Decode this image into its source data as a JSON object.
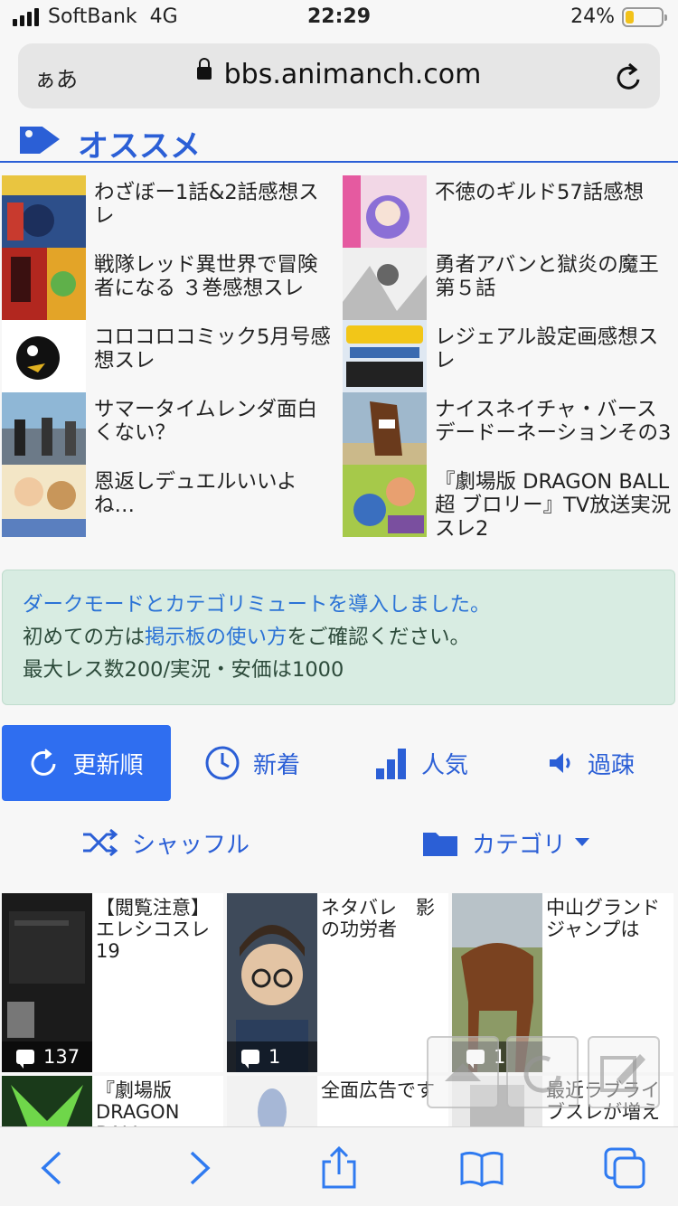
{
  "status": {
    "carrier": "SoftBank",
    "network": "4G",
    "time": "22:29",
    "battery": "24%",
    "battery_level": 0.24
  },
  "urlbar": {
    "aa": "ぁあ",
    "url": "bbs.animanch.com"
  },
  "recommended": {
    "title": "オススメ",
    "items": [
      {
        "title": "わざぼー1話&2話感想スレ"
      },
      {
        "title": "不徳のギルド57話感想"
      },
      {
        "title": "戦隊レッド異世界で冒険者になる ３巻感想スレ"
      },
      {
        "title": "勇者アバンと獄炎の魔王　第５話"
      },
      {
        "title": "コロコロコミック5月号感想スレ"
      },
      {
        "title": "レジェアル設定画感想スレ"
      },
      {
        "title": "サマータイムレンダ面白くない？"
      },
      {
        "title": "ナイスネイチャ・バースデードーネーションその3"
      },
      {
        "title": "恩返しデュエルいいよね…"
      },
      {
        "title": "『劇場版 DRAGON BALL超 ブロリー』TV放送実況スレ2"
      }
    ]
  },
  "notice": {
    "line1": "ダークモードとカテゴリミュートを導入しました。",
    "line2_pre": "初めての方は",
    "line2_link": "掲示板の使い方",
    "line2_post": "をご確認ください。",
    "line3": "最大レス数200/実況・安価は1000"
  },
  "sort": {
    "update": "更新順",
    "new": "新着",
    "popular": "人気",
    "sparse": "過疎",
    "shuffle": "シャッフル",
    "category": "カテゴリ"
  },
  "threads": [
    {
      "title": "【閲覧注意】エレシコスレ19",
      "count": "137"
    },
    {
      "title": "ネタバレ　影の功労者",
      "count": "1"
    },
    {
      "title": "中山グランドジャンプは",
      "count": "1"
    },
    {
      "title": "『劇場版 DRAGON BALL",
      "count": ""
    },
    {
      "title": "全面広告です",
      "count": ""
    },
    {
      "title": "最近ラブライブスレが増え",
      "count": ""
    }
  ],
  "colors": {
    "accent": "#2b5fd6",
    "button": "#2f6ef0",
    "notice_bg": "#d8ece2"
  }
}
